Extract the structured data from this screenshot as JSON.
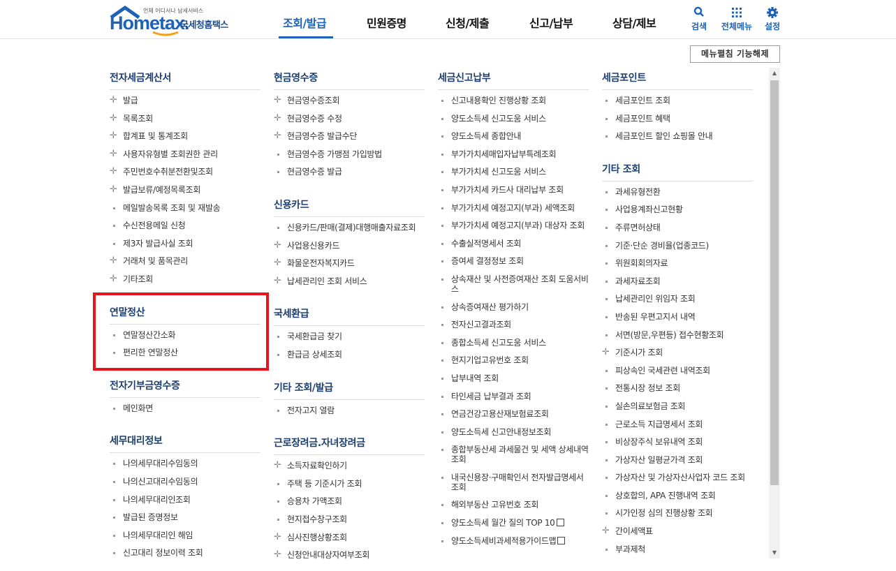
{
  "logo": {
    "tagline": "언제 어디서나 납세서비스",
    "word_main": "Home",
    "word_tax": "tax.",
    "kor_name": "국세청홈택스"
  },
  "gnb": [
    {
      "label": "조회/발급",
      "active": true
    },
    {
      "label": "민원증명",
      "active": false
    },
    {
      "label": "신청/제출",
      "active": false
    },
    {
      "label": "신고/납부",
      "active": false
    },
    {
      "label": "상담/제보",
      "active": false
    }
  ],
  "util": {
    "search": {
      "label": "검색",
      "icon": "search-icon"
    },
    "allmenu": {
      "label": "전체메뉴",
      "icon": "grid-icon"
    },
    "settings": {
      "label": "설정",
      "icon": "gear-icon"
    }
  },
  "fold_button": "메뉴펼침 기능해제",
  "colors": {
    "brand": "#1d62b8",
    "title": "#1b3e6e",
    "highlight": "#e8141e"
  },
  "columns": [
    {
      "sections": [
        {
          "title": "전자세금계산서",
          "items": [
            {
              "label": "발급",
              "type": "plus"
            },
            {
              "label": "목록조회",
              "type": "plus"
            },
            {
              "label": "합계표 및 통계조회",
              "type": "plus"
            },
            {
              "label": "사용자유형별 조회권한 관리",
              "type": "plus"
            },
            {
              "label": "주민번호수취분전환및조회",
              "type": "plus"
            },
            {
              "label": "발급보류/예정목록조회",
              "type": "plus"
            },
            {
              "label": "메일발송목록 조회 및 재발송",
              "type": "dot"
            },
            {
              "label": "수신전용메일 신청",
              "type": "dot"
            },
            {
              "label": "제3자 발급사실 조회",
              "type": "dot"
            },
            {
              "label": "거래처 및 품목관리",
              "type": "plus"
            },
            {
              "label": "기타조회",
              "type": "plus"
            }
          ]
        },
        {
          "title": "연말정산",
          "items": [
            {
              "label": "연말정산간소화",
              "type": "dot"
            },
            {
              "label": "편리한 연말정산",
              "type": "dot"
            }
          ]
        },
        {
          "title": "전자기부금영수증",
          "items": [
            {
              "label": "메인화면",
              "type": "dot"
            }
          ]
        },
        {
          "title": "세무대리정보",
          "items": [
            {
              "label": "나의세무대리수임동의",
              "type": "dot"
            },
            {
              "label": "나의신고대리수임동의",
              "type": "dot"
            },
            {
              "label": "나의세무대리인조회",
              "type": "dot"
            },
            {
              "label": "발급된 증명정보",
              "type": "dot"
            },
            {
              "label": "나의세무대리인 해임",
              "type": "dot"
            },
            {
              "label": "신고대리 정보이력 조회",
              "type": "dot"
            }
          ]
        }
      ]
    },
    {
      "sections": [
        {
          "title": "현금영수증",
          "items": [
            {
              "label": "현금영수증조회",
              "type": "plus"
            },
            {
              "label": "현금영수증 수정",
              "type": "plus"
            },
            {
              "label": "현금영수증 발급수단",
              "type": "plus"
            },
            {
              "label": "현금영수증 가맹점 가입방법",
              "type": "dot"
            },
            {
              "label": "현금영수증 발급",
              "type": "dot"
            }
          ]
        },
        {
          "title": "신용카드",
          "items": [
            {
              "label": "신용카드/판매(결제)대행매출자료조회",
              "type": "dot"
            },
            {
              "label": "사업용신용카드",
              "type": "plus"
            },
            {
              "label": "화물운전자복지카드",
              "type": "plus"
            },
            {
              "label": "납세관리인 조회 서비스",
              "type": "plus"
            }
          ]
        },
        {
          "title": "국세환급",
          "items": [
            {
              "label": "국세환급금 찾기",
              "type": "dot"
            },
            {
              "label": "환급금 상세조회",
              "type": "dot"
            }
          ]
        },
        {
          "title": "기타 조회/발급",
          "items": [
            {
              "label": "전자고지 열람",
              "type": "dot"
            }
          ]
        },
        {
          "title": "근로장려금.자녀장려금",
          "items": [
            {
              "label": "소득자료확인하기",
              "type": "plus"
            },
            {
              "label": "주택 등 기준시가 조회",
              "type": "dot"
            },
            {
              "label": "승용차 가액조회",
              "type": "dot"
            },
            {
              "label": "현지접수창구조회",
              "type": "dot"
            },
            {
              "label": "심사진행상황조회",
              "type": "plus"
            },
            {
              "label": "신청안내대상자여부조회",
              "type": "plus"
            }
          ]
        }
      ]
    },
    {
      "sections": [
        {
          "title": "세금신고납부",
          "items": [
            {
              "label": "신고내용확인 진행상황 조회",
              "type": "dot"
            },
            {
              "label": "양도소득세 신고도움 서비스",
              "type": "dot"
            },
            {
              "label": "양도소득세 종합안내",
              "type": "dot"
            },
            {
              "label": "부가가치세매입자납부특례조회",
              "type": "dot"
            },
            {
              "label": "부가가치세 신고도움 서비스",
              "type": "dot"
            },
            {
              "label": "부가가치세 카드사 대리납부 조회",
              "type": "dot"
            },
            {
              "label": "부가가치세 예정고지(부과) 세액조회",
              "type": "dot"
            },
            {
              "label": "부가가치세 예정고지(부과) 대상자 조회",
              "type": "dot"
            },
            {
              "label": "수출실적명세서 조회",
              "type": "dot"
            },
            {
              "label": "증여세 결정정보 조회",
              "type": "dot"
            },
            {
              "label": "상속재산 및 사전증여재산 조회 도움서비스",
              "type": "dot"
            },
            {
              "label": "상속증여재산 평가하기",
              "type": "dot"
            },
            {
              "label": "전자신고결과조회",
              "type": "dot"
            },
            {
              "label": "종합소득세 신고도움 서비스",
              "type": "dot"
            },
            {
              "label": "현지기업고유번호 조회",
              "type": "dot"
            },
            {
              "label": "납부내역 조회",
              "type": "dot"
            },
            {
              "label": "타인세금 납부결과 조회",
              "type": "dot"
            },
            {
              "label": "연금건강고용산재보험료조회",
              "type": "dot"
            },
            {
              "label": "양도소득세 신고안내정보조회",
              "type": "dot"
            },
            {
              "label": "종합부동산세 과세물건 및 세액 상세내역 조회",
              "type": "dot"
            },
            {
              "label": "내국신용장·구매확인서 전자발급명세서 조회",
              "type": "dot"
            },
            {
              "label": "해외부동산 고유번호 조회",
              "type": "dot"
            },
            {
              "label": "양도소득세 월간 질의 TOP 10",
              "type": "dot",
              "ext": true
            },
            {
              "label": "양도소득세비과세적용가이드맵",
              "type": "dot",
              "ext": true
            }
          ]
        }
      ]
    },
    {
      "sections": [
        {
          "title": "세금포인트",
          "items": [
            {
              "label": "세금포인트 조회",
              "type": "dot"
            },
            {
              "label": "세금포인트 혜택",
              "type": "dot"
            },
            {
              "label": "세금포인트 할인 쇼핑몰 안내",
              "type": "dot"
            }
          ]
        },
        {
          "title": "기타 조회",
          "items": [
            {
              "label": "과세유형전환",
              "type": "dot"
            },
            {
              "label": "사업용계좌신고현황",
              "type": "dot"
            },
            {
              "label": "주류면허상태",
              "type": "dot"
            },
            {
              "label": "기준·단순 경비율(업종코드)",
              "type": "dot"
            },
            {
              "label": "위원회회의자료",
              "type": "dot"
            },
            {
              "label": "과세자료조회",
              "type": "dot"
            },
            {
              "label": "납세관리인 위임자 조회",
              "type": "dot"
            },
            {
              "label": "반송된 우편고지서 내역",
              "type": "dot"
            },
            {
              "label": "서면(방문,우편등) 접수현황조회",
              "type": "dot"
            },
            {
              "label": "기준시가 조회",
              "type": "plus"
            },
            {
              "label": "피상속인 국세관련 내역조회",
              "type": "dot"
            },
            {
              "label": "전통시장 정보 조회",
              "type": "dot"
            },
            {
              "label": "실손의료보험금 조회",
              "type": "dot"
            },
            {
              "label": "근로소득 지급명세서 조회",
              "type": "dot"
            },
            {
              "label": "비상장주식 보유내역 조회",
              "type": "dot"
            },
            {
              "label": "가상자산 일평균가격 조회",
              "type": "dot"
            },
            {
              "label": "가상자산 및 가상자산사업자 코드 조회",
              "type": "dot"
            },
            {
              "label": "상호합의, APA 진행내역 조회",
              "type": "dot"
            },
            {
              "label": "시가인정 심의 진행상황 조회",
              "type": "dot"
            },
            {
              "label": "간이세액표",
              "type": "plus"
            },
            {
              "label": "부과제척",
              "type": "dot"
            }
          ]
        }
      ]
    }
  ]
}
